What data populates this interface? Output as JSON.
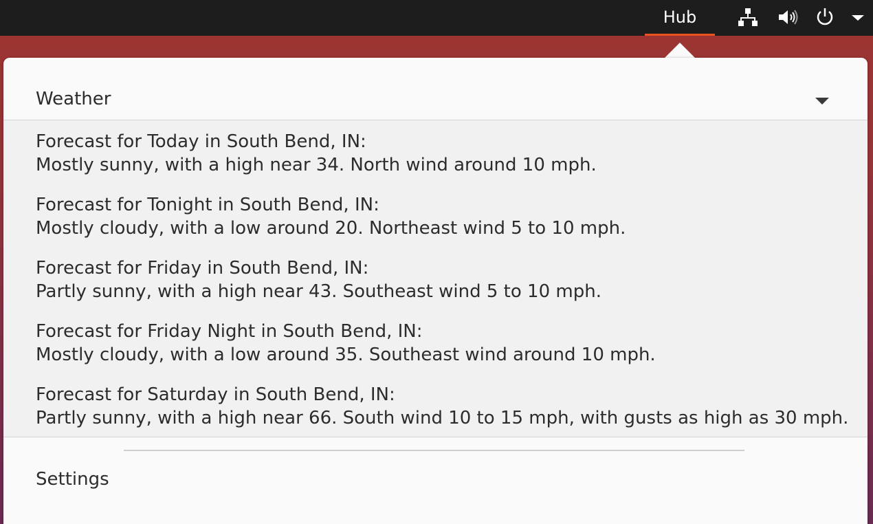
{
  "topbar": {
    "indicator_label": "Hub",
    "icons": [
      "network-wired-icon",
      "volume-icon",
      "power-icon",
      "system-menu-chevron-icon"
    ]
  },
  "colors": {
    "panel_bg": "#1d1d1d",
    "accent": "#e95420",
    "menu_bg": "#fafafa",
    "submenu_bg": "#f1f1f1"
  },
  "menu": {
    "header_label": "Weather",
    "forecasts": [
      {
        "title": "Forecast for Today in South Bend, IN:",
        "detail": "Mostly sunny, with a high near 34. North wind around 10 mph."
      },
      {
        "title": "Forecast for Tonight in South Bend, IN:",
        "detail": "Mostly cloudy, with a low around 20. Northeast wind 5 to 10 mph."
      },
      {
        "title": "Forecast for Friday in South Bend, IN:",
        "detail": "Partly sunny, with a high near 43. Southeast wind 5 to 10 mph."
      },
      {
        "title": "Forecast for Friday Night in South Bend, IN:",
        "detail": "Mostly cloudy, with a low around 35. Southeast wind around 10 mph."
      },
      {
        "title": "Forecast for Saturday in South Bend, IN:",
        "detail": "Partly sunny, with a high near 66. South wind 10 to 15 mph, with gusts as high as 30 mph."
      }
    ],
    "settings_label": "Settings"
  }
}
